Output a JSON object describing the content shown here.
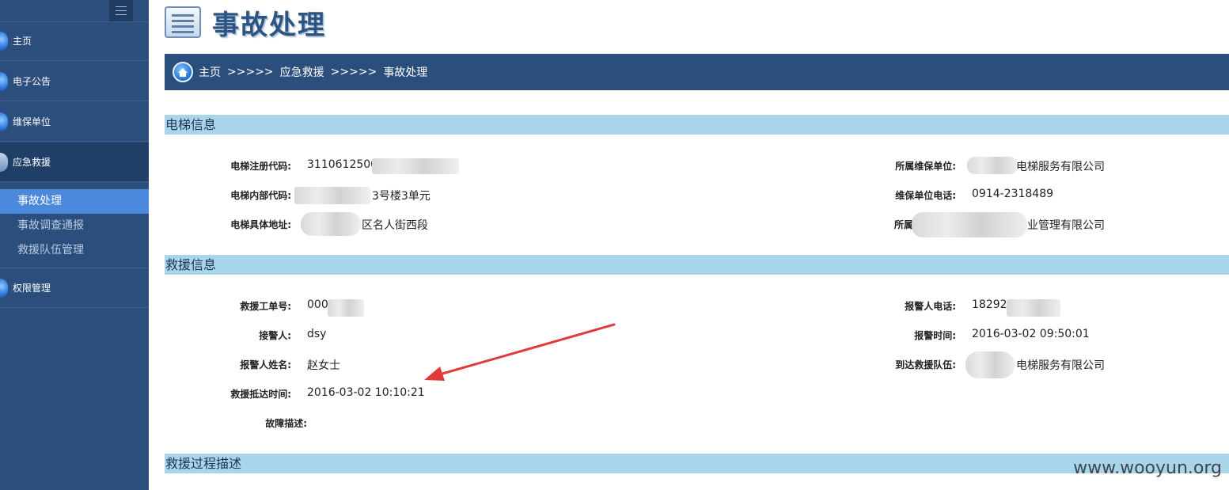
{
  "sidebar": {
    "items": [
      {
        "label": "主页"
      },
      {
        "label": "电子公告"
      },
      {
        "label": "维保单位"
      },
      {
        "label": "应急救援"
      },
      {
        "label": "权限管理"
      }
    ],
    "sub_items": [
      {
        "label": "事故处理"
      },
      {
        "label": "事故调查通报"
      },
      {
        "label": "救援队伍管理"
      }
    ]
  },
  "header": {
    "title": "事故处理"
  },
  "breadcrumb": {
    "home": "主页",
    "sep1": ">>>>>",
    "mid": "应急救援",
    "sep2": ">>>>>",
    "current": "事故处理"
  },
  "elevator_info": {
    "section_title": "电梯信息",
    "fields": {
      "reg_code_label": "电梯注册代码:",
      "reg_code_value": "3110612500",
      "internal_code_label": "电梯内部代码:",
      "internal_code_value": "3号楼3单元",
      "address_label": "电梯具体地址:",
      "address_value": "区名人街西段",
      "maint_unit_label": "所属维保单位:",
      "maint_unit_value": "电梯服务有限公司",
      "maint_phone_label": "维保单位电话:",
      "maint_phone_value": "0914-2318489",
      "owner_label": "所属",
      "owner_value": "业管理有限公司"
    }
  },
  "rescue_info": {
    "section_title": "救援信息",
    "fields": {
      "order_no_label": "救援工单号:",
      "order_no_value": "000",
      "receiver_label": "接警人:",
      "receiver_value": "dsy",
      "reporter_name_label": "报警人姓名:",
      "reporter_name_value": "赵女士",
      "arrive_time_label": "救援抵达时间:",
      "arrive_time_value": "2016-03-02 10:10:21",
      "fault_desc_label": "故障描述:",
      "reporter_phone_label": "报警人电话:",
      "reporter_phone_value": "18292",
      "report_time_label": "报警时间:",
      "report_time_value": "2016-03-02 09:50:01",
      "team_label": "到达救援队伍:",
      "team_value": "电梯服务有限公司"
    }
  },
  "process": {
    "section_title": "救援过程描述"
  },
  "watermark": "www.wooyun.org",
  "colors": {
    "sidebar": "#2c4e7c",
    "sidebar_selected": "#4a89dc",
    "section_bar": "#a8d4ec",
    "arrow": "#e03a3a"
  }
}
